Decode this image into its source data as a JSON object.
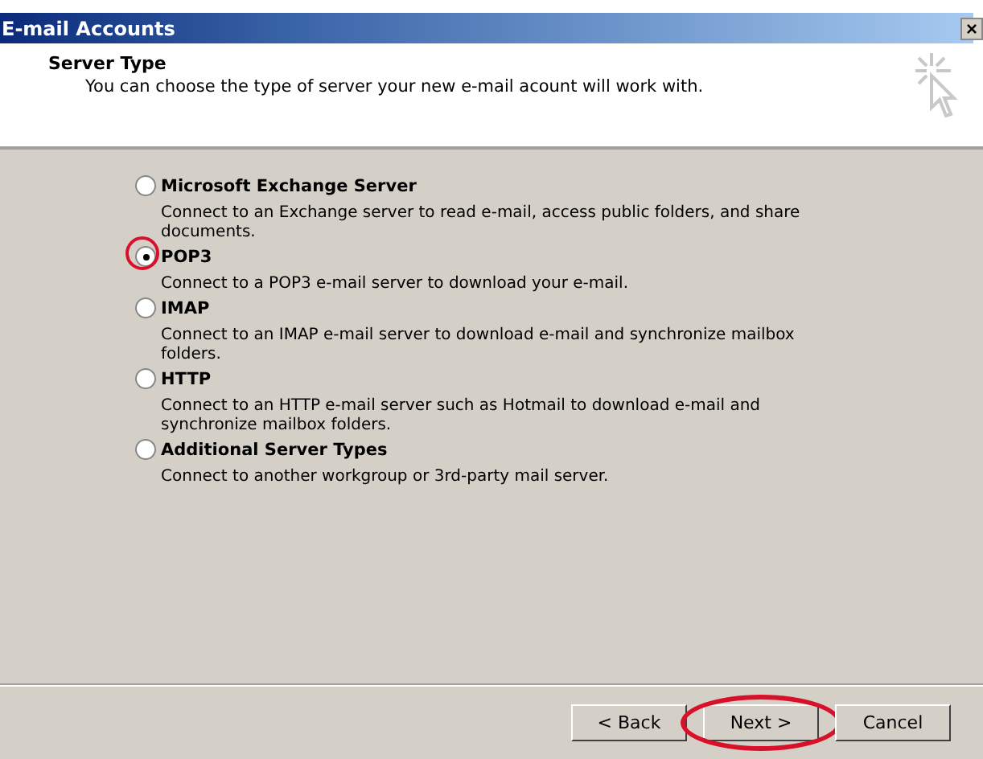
{
  "window": {
    "title": "E-mail Accounts",
    "close": "×"
  },
  "header": {
    "title": "Server Type",
    "subtitle": "You can choose the type of server your new e-mail acount will work with."
  },
  "options": [
    {
      "label": "Microsoft Exchange Server",
      "description": "Connect to an Exchange server to read e-mail, access public folders, and share documents.",
      "selected": false,
      "highlighted": false
    },
    {
      "label": "POP3",
      "description": "Connect to a POP3 e-mail server to download your e-mail.",
      "selected": true,
      "highlighted": true
    },
    {
      "label": "IMAP",
      "description": "Connect to an IMAP e-mail server to download e-mail and synchronize mailbox folders.",
      "selected": false,
      "highlighted": false
    },
    {
      "label": "HTTP",
      "description": "Connect to an HTTP e-mail server such as Hotmail to download e-mail and synchronize mailbox folders.",
      "selected": false,
      "highlighted": false
    },
    {
      "label": "Additional Server Types",
      "description": "Connect to another workgroup or 3rd-party mail server.",
      "selected": false,
      "highlighted": false
    }
  ],
  "buttons": [
    {
      "label": "< Back",
      "highlighted": false
    },
    {
      "label": "Next >",
      "highlighted": true
    },
    {
      "label": "Cancel",
      "highlighted": false
    }
  ]
}
